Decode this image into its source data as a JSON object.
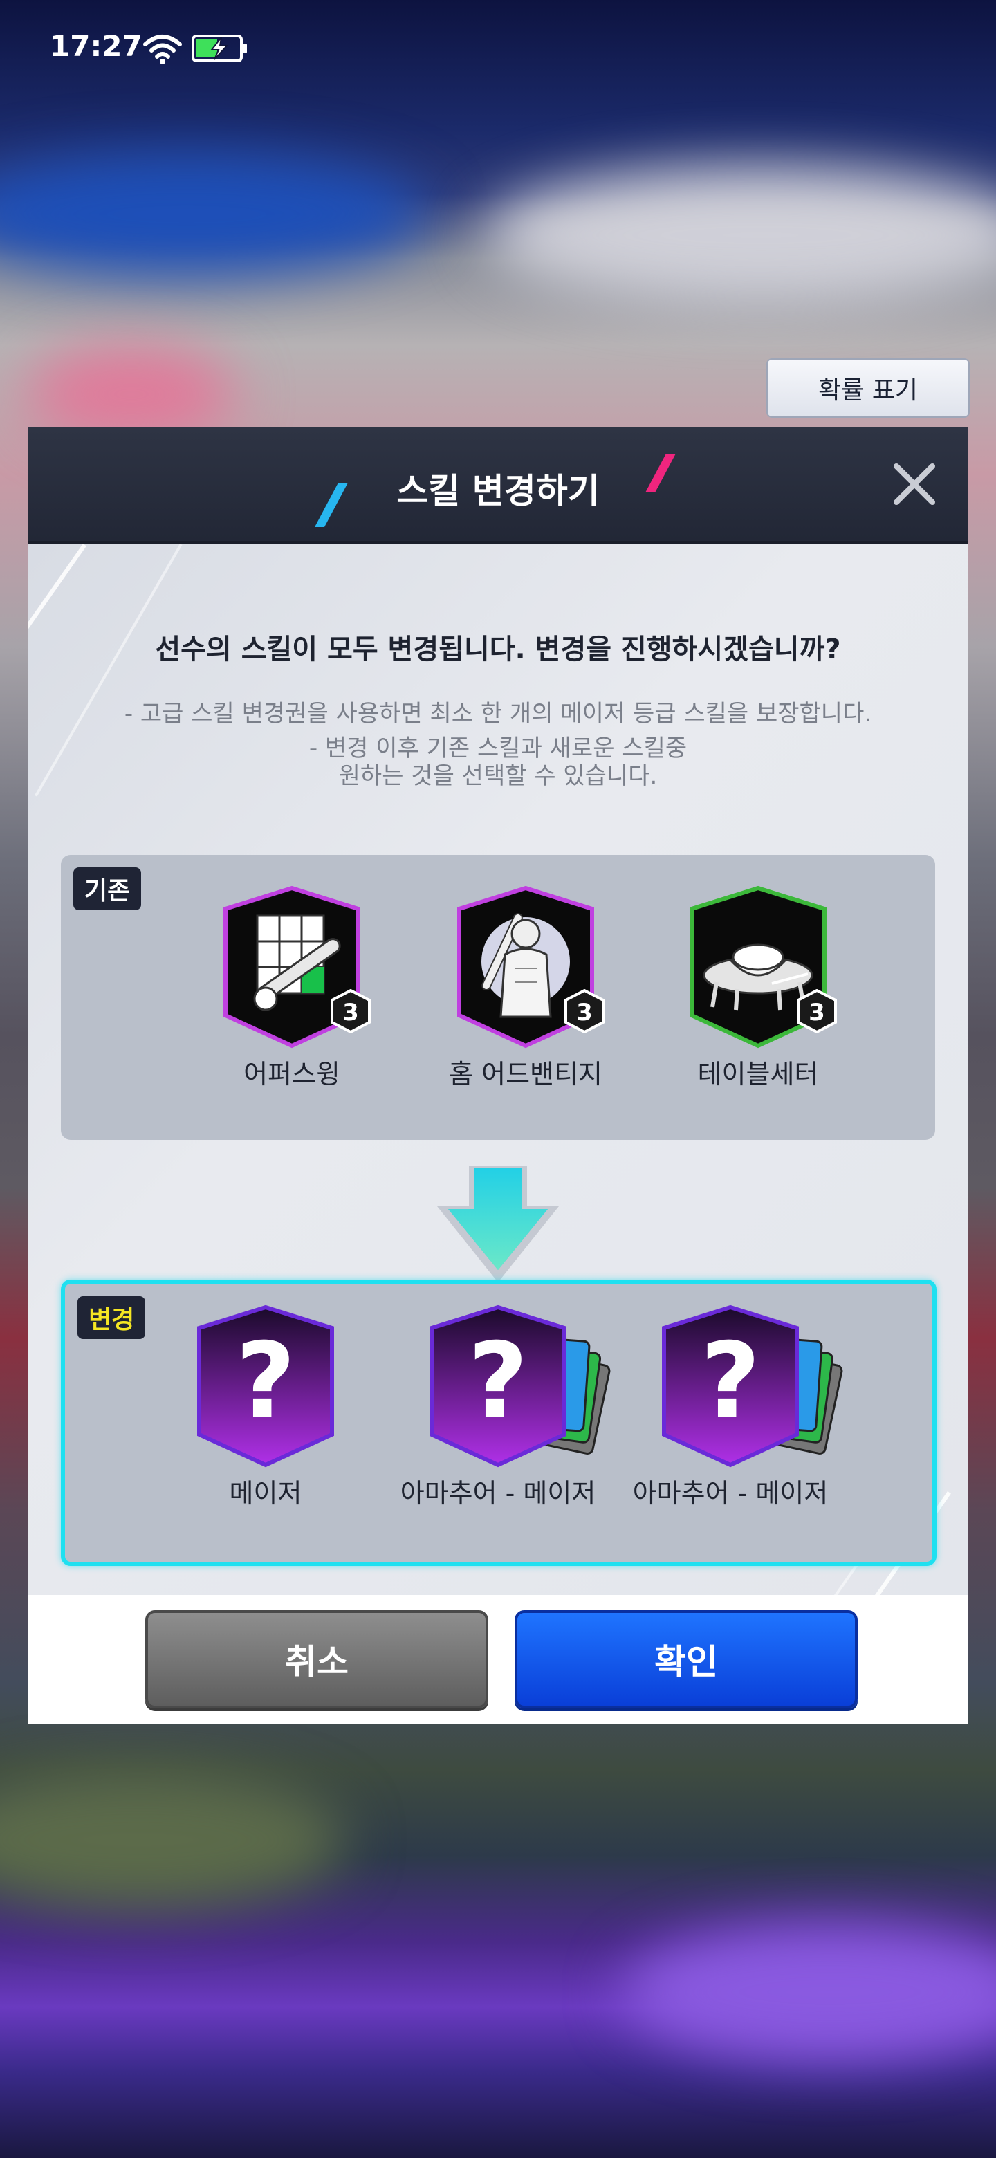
{
  "status_bar": {
    "time": "17:27",
    "icons": [
      "wifi-icon",
      "battery-charging-icon"
    ]
  },
  "probability_button": {
    "label": "확률 표기"
  },
  "dialog": {
    "title": "스킬 변경하기",
    "question": "선수의 스킬이 모두 변경됩니다. 변경을 진행하시겠습니까?",
    "note_1": "- 고급 스킬 변경권을 사용하면 최소 한 개의 메이저 등급 스킬을 보장합니다.",
    "note_2_line1": "- 변경 이후 기존 스킬과 새로운 스킬중",
    "note_2_line2": "원하는 것을 선택할 수 있습니다.",
    "current": {
      "tag": "기존",
      "skills": [
        {
          "name": "어퍼스윙",
          "level": "3",
          "icon": "bat-strike-zone-icon"
        },
        {
          "name": "홈 어드밴티지",
          "level": "3",
          "icon": "batter-player-icon"
        },
        {
          "name": "테이블세터",
          "level": "3",
          "icon": "rice-bowl-table-icon"
        }
      ]
    },
    "changed": {
      "tag": "변경",
      "skills": [
        {
          "name": "메이저",
          "icon": "question-mark-icon"
        },
        {
          "name": "아마추어 - 메이저",
          "icon": "question-mark-stack-icon"
        },
        {
          "name": "아마추어 - 메이저",
          "icon": "question-mark-stack-icon"
        }
      ]
    },
    "buttons": {
      "cancel": "취소",
      "confirm": "확인"
    }
  },
  "colors": {
    "header": "#262b3a",
    "accent_cyan": "#1fe0f0",
    "confirm_blue": "#0a4bea",
    "cancel_gray": "#6e6e6e",
    "tag_new_text": "#f5e623",
    "mystery_purple": "#9b2ad8"
  }
}
